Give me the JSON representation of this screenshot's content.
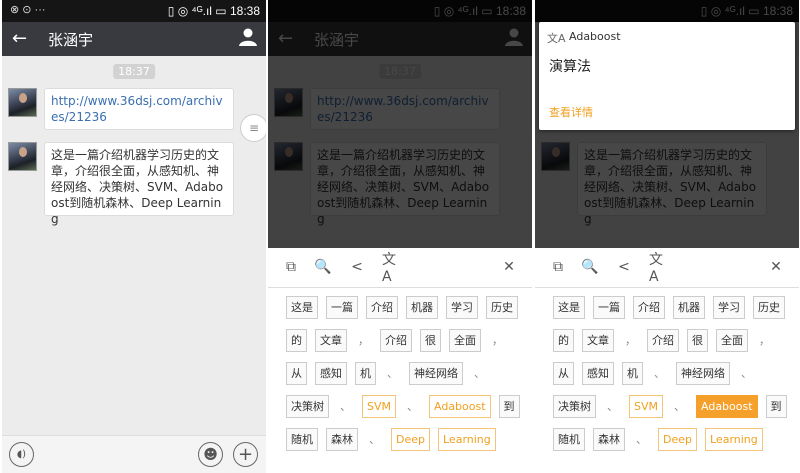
{
  "status": {
    "left_icons": "⊗ ⊙ ···",
    "time": "18:38",
    "icons": "▯ ◎ ⁴ᴳ.ıl ▭"
  },
  "chat": {
    "contact": "张涵宇",
    "timestamp": "18:37",
    "messages": [
      {
        "text": "http://www.36dsj.com/archives/21236",
        "kind": "link"
      },
      {
        "text": "这是一篇介绍机器学习历史的文章，介绍很全面，从感知机、神经网络、决策树、SVM、Adaboost到随机森林、Deep Learning",
        "kind": "text"
      }
    ]
  },
  "tools": {
    "copy": "⧉",
    "search": "🔍",
    "share": "<",
    "translate": "文A",
    "close": "✕"
  },
  "tokens": [
    "这是",
    "一篇",
    "介绍",
    "机器",
    "学习",
    "历史",
    "的",
    "文章",
    "，",
    "介绍",
    "很",
    "全面",
    "，",
    "从",
    "感知",
    "机",
    "、",
    "神经网络",
    "、",
    "决策树",
    "、",
    "SVM",
    "、",
    "Adaboost",
    "到",
    "随机",
    "森林",
    "、",
    "Deep",
    "Learning"
  ],
  "popup": {
    "source": "Adaboost",
    "result": "演算法",
    "more": "查看详情"
  },
  "colors": {
    "accent": "#f5a02b",
    "titlebar": "#393a3f",
    "link": "#3a6fb0"
  }
}
